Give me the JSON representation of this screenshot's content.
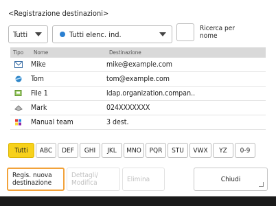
{
  "title": "<Registrazione destinazioni>",
  "filter_dropdown": {
    "value": "Tutti"
  },
  "book_dropdown": {
    "value": "Tutti elenc. ind."
  },
  "search": {
    "label_line1": "Ricerca per",
    "label_line2": "nome"
  },
  "table": {
    "headers": {
      "type": "Tipo",
      "name": "Nome",
      "destination": "Destinazione"
    },
    "rows": [
      {
        "icon": "email-icon",
        "name": "Mike",
        "destination": "mike@example.com"
      },
      {
        "icon": "ifax-icon",
        "name": "Tom",
        "destination": "tom@example.com"
      },
      {
        "icon": "file-server-icon",
        "name": "File 1",
        "destination": "ldap.organization.compan.."
      },
      {
        "icon": "fax-icon",
        "name": "Mark",
        "destination": "024XXXXXXX"
      },
      {
        "icon": "group-icon",
        "name": "Manual team",
        "destination": "3 dest."
      }
    ]
  },
  "alpha_tabs": [
    "Tutti",
    "ABC",
    "DEF",
    "GHI",
    "JKL",
    "MNO",
    "PQR",
    "STU",
    "VWX",
    "YZ",
    "0-9"
  ],
  "buttons": {
    "register_line1": "Regis. nuova",
    "register_line2": "destinazione",
    "edit_line1": "Dettagli/",
    "edit_line2": "Modifica",
    "delete": "Elimina",
    "close": "Chiudi"
  },
  "colors": {
    "active_tab": "#f7d11b",
    "highlight": "#f2a23a"
  }
}
